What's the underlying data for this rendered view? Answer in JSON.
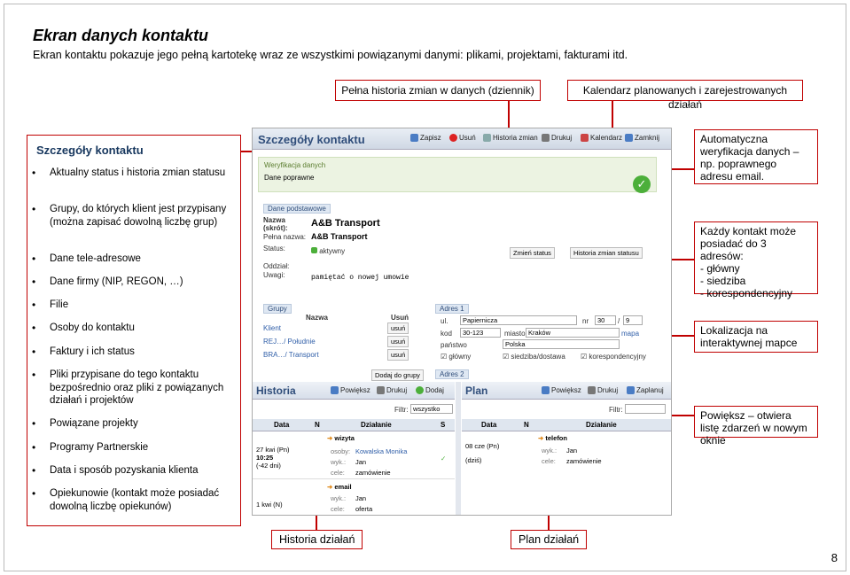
{
  "title": "Ekran danych kontaktu",
  "subtitle": "Ekran kontaktu pokazuje jego pełną kartotekę wraz ze wszystkimi powiązanymi danymi: plikami, projektami, fakturami itd.",
  "callouts": {
    "history_log": "Pełna historia zmian w danych (dziennik)",
    "calendar": "Kalendarz planowanych i zarejestrowanych działań",
    "auto_verify": "Automatyczna weryfikacja danych – np. poprawnego adresu email.",
    "addresses": "Każdy kontakt może posiadać do 3 adresów:\n- główny\n- siedziba\n- korespondencyjny",
    "map": "Lokalizacja na interaktywnej mapce",
    "enlarge": "Powiększ – otwiera listę zdarzeń w nowym oknie"
  },
  "left_panel": {
    "heading": "Szczegóły kontaktu",
    "items": [
      "Aktualny status i historia zmian statusu",
      "Grupy, do których klient jest przypisany (można zapisać dowolną liczbę grup)",
      "Dane tele-adresowe",
      "Dane firmy (NIP, REGON, …)",
      "Filie",
      "Osoby do kontaktu",
      "Faktury i ich status",
      "Pliki przypisane do tego kontaktu bezpośrednio oraz pliki z powiązanych działań i projektów",
      "Powiązane projekty",
      "Programy Partnerskie",
      "Data i sposób pozyskania klienta",
      "Opiekunowie (kontakt może posiadać dowolną liczbę opiekunów)"
    ]
  },
  "app": {
    "header": "Szczegóły kontaktu",
    "toolbar": [
      "Zapisz",
      "Usuń",
      "Historia zmian",
      "Drukuj",
      "Kalendarz",
      "Zamknij"
    ],
    "verification": {
      "label": "Weryfikacja danych",
      "value": "Dane poprawne"
    },
    "basic": {
      "section": "Dane podstawowe",
      "short_name_label": "Nazwa (skrót):",
      "short_name": "A&B Transport",
      "full_name_label": "Pełna nazwa:",
      "full_name": "A&B Transport",
      "status_label": "Status:",
      "status": "aktywny",
      "change_status": "Zmień status",
      "status_history": "Historia zmian statusu",
      "branch_label": "Oddział:",
      "notes_label": "Uwagi:",
      "notes": "pamiętać o nowej umowie"
    },
    "groups": {
      "section": "Grupy",
      "col_name": "Nazwa",
      "col_remove": "Usuń",
      "rows": [
        "Klient",
        "REJ…/ Południe",
        "BRA…/ Transport"
      ],
      "remove_label": "usuń",
      "add": "Dodaj do grupy"
    },
    "address": {
      "tab1": "Adres 1",
      "tab2": "Adres 2",
      "street_label": "ul.",
      "street": "Papiernicza",
      "nr_label": "nr",
      "nr1": "30",
      "nr2": "9",
      "zip_label": "kod",
      "zip": "30-123",
      "city_label": "miasto",
      "city": "Kraków",
      "map": "mapa",
      "country_label": "państwo",
      "country": "Polska",
      "types": [
        "główny",
        "siedziba/dostawa",
        "korespondencyjny"
      ]
    },
    "history": {
      "header": "Historia",
      "buttons": [
        "Powiększ",
        "Drukuj",
        "Dodaj"
      ],
      "filter_label": "Filtr:",
      "filter_value": "wszystko",
      "cols": [
        "Data",
        "N",
        "Działanie",
        "S"
      ],
      "entries": [
        {
          "date": "27 kwi (Pn)",
          "time": "10:25",
          "ago": "(-42 dni)",
          "type": "wizyta",
          "person_label": "osoby:",
          "person": "Kowalska Monika",
          "by_label": "wyk.:",
          "by": "Jan",
          "goal_label": "cele:",
          "goal": "zamówienie"
        },
        {
          "date": "",
          "time": "",
          "ago": "",
          "type": "email",
          "by_label": "wyk.:",
          "by": "Jan",
          "goal_label": "cele:",
          "goal": "oferta"
        }
      ],
      "partial_date": "1 kwi (N)"
    },
    "plan": {
      "header": "Plan",
      "buttons": [
        "Powiększ",
        "Drukuj",
        "Zaplanuj"
      ],
      "filter_label": "Filtr:",
      "cols": [
        "Data",
        "N",
        "Działanie"
      ],
      "entries": [
        {
          "date": "08 cze (Pn)",
          "ago": "(dziś)",
          "type": "telefon",
          "by_label": "wyk.:",
          "by": "Jan",
          "goal_label": "cele:",
          "goal": "zamówienie"
        }
      ]
    }
  },
  "bottom_labels": {
    "history": "Historia działań",
    "plan": "Plan działań"
  },
  "page_number": "8"
}
